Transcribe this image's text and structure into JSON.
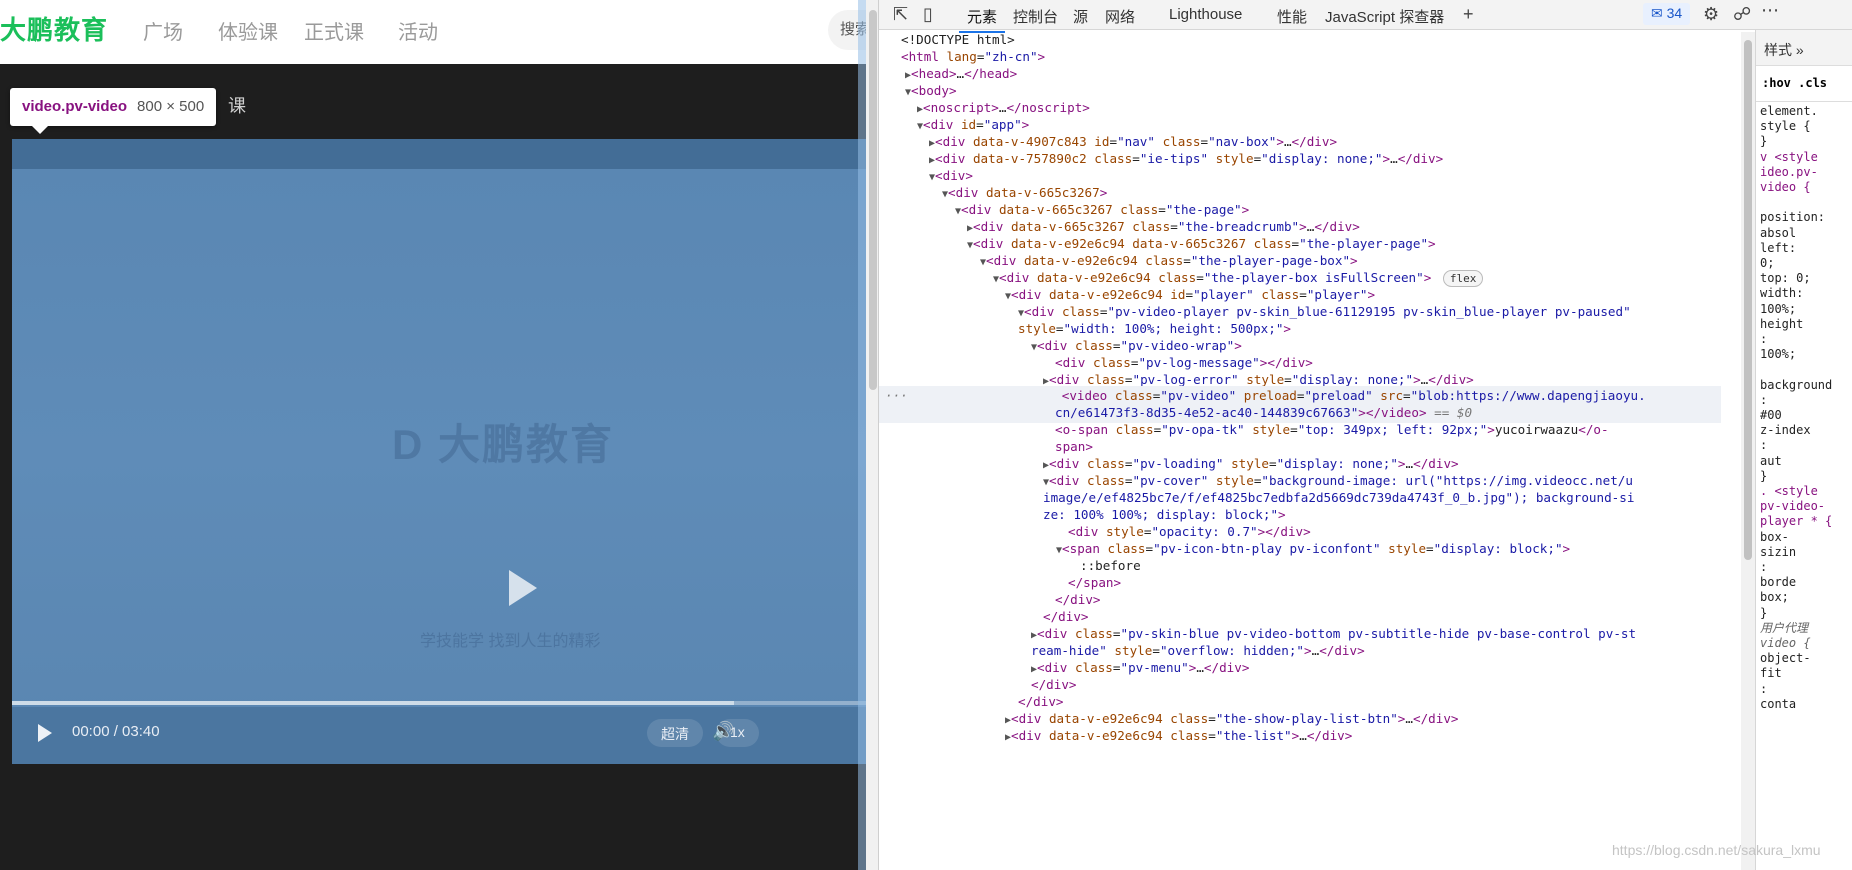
{
  "site": {
    "logo": "大鹏教育",
    "nav": [
      "广场",
      "体验课",
      "正式课",
      "活动"
    ],
    "search_placeholder": "搜索i",
    "breadcrumb_tail": "课"
  },
  "inspect_tooltip": {
    "tag": "video.pv-video",
    "dims": "800 × 500"
  },
  "player": {
    "watermark_logo": "D 大鹏教育",
    "watermark_slogan": "学技能学 找到人生的精彩",
    "time": "00:00 / 03:40",
    "quality": "超清",
    "speed": "1x"
  },
  "devtools": {
    "tabs": [
      "元素",
      "控制台",
      "源",
      "网络",
      "Lighthouse",
      "性能",
      "JavaScript 探查器"
    ],
    "active_tab": "元素",
    "issues_count": "34",
    "styles_tabs": "样式  »",
    "styles_filter": ":hov  .cls",
    "styles_lines": [
      "element.",
      "style {",
      "}",
      "v   <style",
      "ideo.pv-",
      "video {",
      "",
      "position:",
      "    absol",
      "  left:",
      "    0;",
      "  top: 0;",
      "  width:",
      "    100%;",
      "  height",
      "    :",
      "    100%;",
      "",
      "background",
      "  :",
      "  #00",
      "  z-index",
      "    :",
      "  aut",
      "}",
      ".   <style",
      "pv-video-",
      "player * {",
      "  box-",
      "    sizin",
      "    :",
      "    borde",
      "    box;",
      "}",
      " 用户代理",
      "video {",
      "  object-",
      "    fit",
      "    :",
      "    conta"
    ]
  },
  "watermark": "https://blog.csdn.net/sakura_lxmu"
}
